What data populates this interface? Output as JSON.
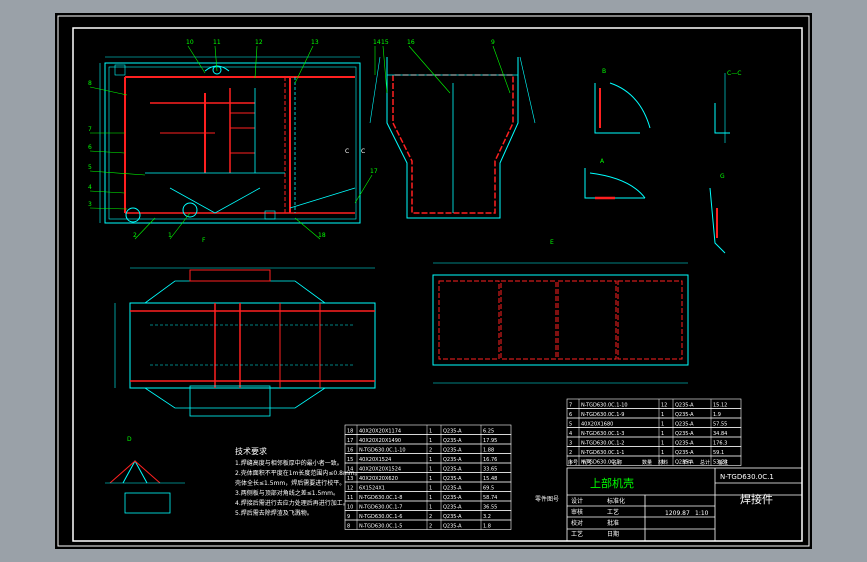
{
  "colors": {
    "outline": "#00ffff",
    "weld": "#ff2020",
    "frame": "#ffffff",
    "leader": "#00ff00",
    "hidden": "#ff3030"
  },
  "labels": {
    "balloons": [
      "8",
      "10",
      "11",
      "12",
      "13",
      "14",
      "15",
      "16",
      "9",
      "7",
      "6",
      "5",
      "4",
      "3",
      "2",
      "1",
      "17",
      "18"
    ],
    "section_marks": {
      "view_f": "F",
      "view_c": "C—C",
      "view_b": "B",
      "view_a": "A",
      "view_e": "E",
      "view_d": "D",
      "view_g": "G"
    }
  },
  "tech_notes": {
    "title": "技术要求",
    "lines": [
      "1.焊缝高度与相邻板厚中的最小者一致。",
      "2.壳体面积不平度在1m长度范围内≤0.8mm。",
      "  壳体全长≤1.5mm，焊后需要进行校平。",
      "3.两侧板与顶部对角线之差≤1.5mm。",
      "4.焊接后需进行去应力处理后再进行加工。",
      "5.焊后需去除焊渣及飞溅物。"
    ]
  },
  "bom_left": {
    "rows": [
      [
        "18",
        "40X20X20X1174",
        "1",
        "Q235-A",
        "6.25"
      ],
      [
        "17",
        "40X20X20X1490",
        "1",
        "Q235-A",
        "17.95"
      ],
      [
        "16",
        "N-TGD630.0C.1-10",
        "2",
        "Q235-A",
        "1.88"
      ],
      [
        "15",
        "40X20X1524",
        "1",
        "Q235-A",
        "16.76"
      ],
      [
        "14",
        "40X20X20X1524",
        "1",
        "Q235-A",
        "33.65"
      ],
      [
        "13",
        "40X20X20X620",
        "1",
        "Q235-A",
        "15.48"
      ],
      [
        "12",
        "6X1524X1",
        "1",
        "Q235-A",
        "69.5"
      ],
      [
        "11",
        "N-TGD630.0C.1-8",
        "1",
        "Q235-A",
        "58.74"
      ],
      [
        "10",
        "N-TGD630.0C.1-7",
        "1",
        "Q235-A",
        "36.55"
      ],
      [
        "9",
        "N-TGD630.0C.1-6",
        "2",
        "Q235-A",
        "3.2"
      ],
      [
        "8",
        "N-TGD630.0C.1-5",
        "2",
        "Q235-A",
        "1.8"
      ]
    ],
    "caption": "零件图号"
  },
  "bom_right": {
    "rows": [
      [
        "7",
        "N-TGD630.0C.1-10",
        "12",
        "Q235-A",
        "15.12"
      ],
      [
        "6",
        "N-TGD630.0C.1-9",
        "1",
        "Q235-A",
        "1.9"
      ],
      [
        "5",
        "40X20X1680",
        "1",
        "Q235-A",
        "57.55"
      ],
      [
        "4",
        "N-TGD630.0C.1-3",
        "1",
        "Q235-A",
        "34.84"
      ],
      [
        "3",
        "N-TGD630.0C.1-2",
        "1",
        "Q235-A",
        "176.3"
      ],
      [
        "2",
        "N-TGD630.0C.1-1",
        "1",
        "Q235-A",
        "59.1"
      ],
      [
        "1",
        "N-TGD630.0C.1",
        "1",
        "Q235-A",
        "53.28"
      ]
    ],
    "header": [
      "序号",
      "代号",
      "名称",
      "数量",
      "材料",
      "单件",
      "总计",
      "备注"
    ]
  },
  "title_block": {
    "part_name": "上部机壳",
    "drawing_no": "N-TGD630.0C.1",
    "category": "焊接件",
    "weight": "1209.87",
    "scale": "1:10",
    "sheet": "1",
    "rows": [
      [
        "设计",
        "标准化"
      ],
      [
        "审核",
        "工艺"
      ],
      [
        "校对",
        "批准"
      ],
      [
        "工艺",
        "日期"
      ]
    ]
  }
}
